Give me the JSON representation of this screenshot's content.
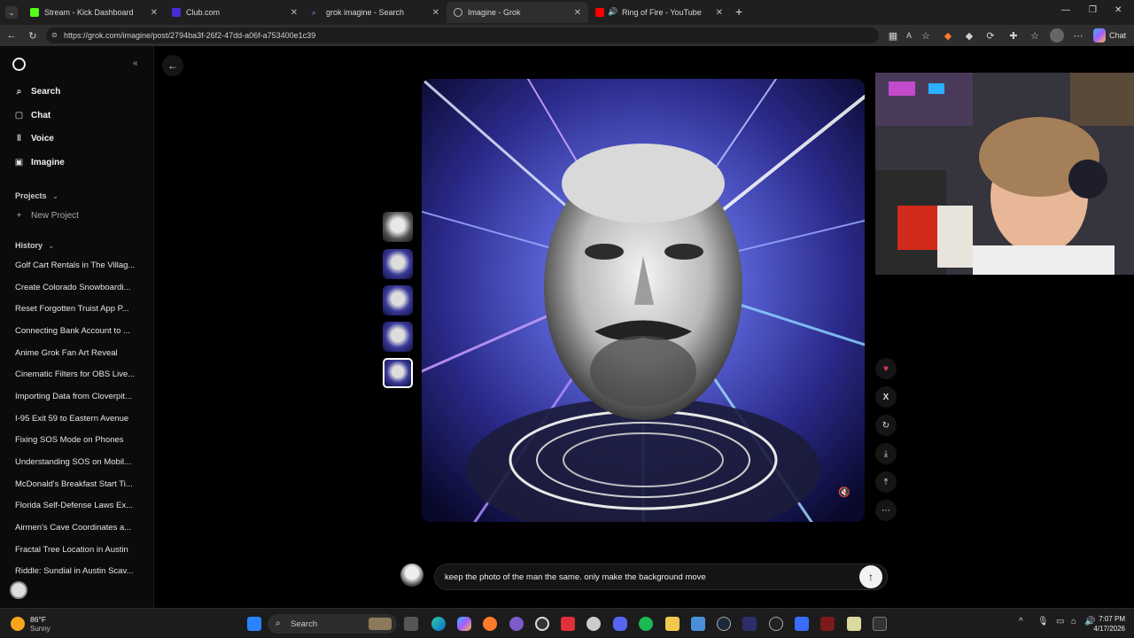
{
  "browser": {
    "tabs": [
      {
        "label": "Stream - Kick Dashboard",
        "color": "#53fc18"
      },
      {
        "label": "Club.com",
        "color": "#4b2bd6"
      },
      {
        "label": "grok imagine - Search",
        "color": "#3b82f6"
      },
      {
        "label": "Imagine - Grok",
        "color": "#9a9a9a"
      },
      {
        "label": "Ring of Fire - YouTube",
        "color": "#ff0000"
      }
    ],
    "url": "https://grok.com/imagine/post/2794ba3f-26f2-47dd-a06f-a753400e1c39",
    "chat_label": "Chat"
  },
  "sidebar": {
    "nav": [
      {
        "label": "Search",
        "icon": "search-icon"
      },
      {
        "label": "Chat",
        "icon": "chat-icon"
      },
      {
        "label": "Voice",
        "icon": "voice-icon"
      },
      {
        "label": "Imagine",
        "icon": "imagine-icon"
      }
    ],
    "projects_label": "Projects",
    "new_project_label": "New Project",
    "history_label": "History",
    "history": [
      "Golf Cart Rentals in The Villag...",
      "Create Colorado Snowboardi...",
      "Reset Forgotten Truist App P...",
      "Connecting Bank Account to ...",
      "Anime Grok Fan Art Reveal",
      "Cinematic Filters for OBS Live...",
      "Importing Data from Cloverpit...",
      "I-95 Exit 59 to Eastern Avenue",
      "Fixing SOS Mode on Phones",
      "Understanding SOS on Mobil...",
      "McDonald's Breakfast Start Ti...",
      "Florida Self-Defense Laws Ex...",
      "Airmen's Cave Coordinates a...",
      "Fractal Tree Location in Austin",
      "Riddle: Sundial in Austin Scav..."
    ]
  },
  "main": {
    "prompt_text": "keep the photo of the man the same. only make the background move"
  },
  "taskbar": {
    "weather_temp": "86°F",
    "weather_desc": "Sunny",
    "search_label": "Search",
    "time": "7:07 PM",
    "date": "4/17/2026"
  }
}
